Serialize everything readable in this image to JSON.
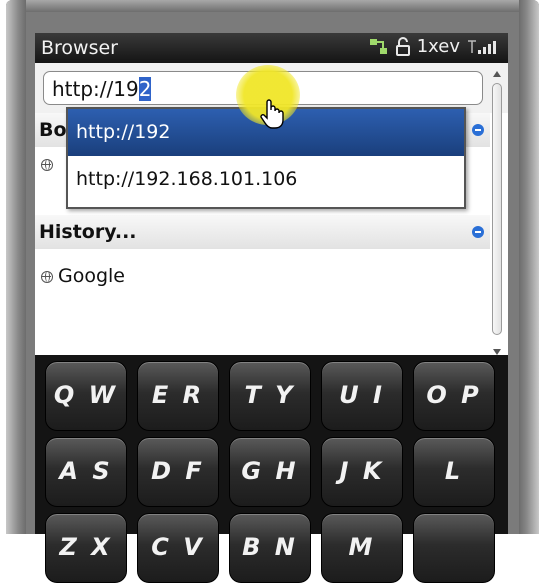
{
  "status_bar": {
    "app_title": "Browser",
    "network": "1xev",
    "icons": [
      "connection-icon",
      "lock-icon",
      "signal-icon"
    ]
  },
  "address_bar": {
    "typed_prefix": "http://19",
    "selected_suffix": "2"
  },
  "dropdown": {
    "items": [
      "http://192",
      "http://192.168.101.106"
    ]
  },
  "sections": {
    "bookmarks_partial": "Bo",
    "history_label": "History...",
    "history_items": [
      "Google"
    ]
  },
  "keyboard": {
    "rows": [
      [
        "Q W",
        "E R",
        "T Y",
        "U I",
        "O P"
      ],
      [
        "A S",
        "D F",
        "G H",
        "J K",
        "L"
      ],
      [
        "Z X",
        "C V",
        "B N",
        "M",
        ""
      ]
    ]
  },
  "colors": {
    "selection": "#2f63c9",
    "dropdown_selected": "#2d5fb0",
    "section_arrow": "#2a6fd6",
    "cursor_highlight": "#f0e628"
  }
}
